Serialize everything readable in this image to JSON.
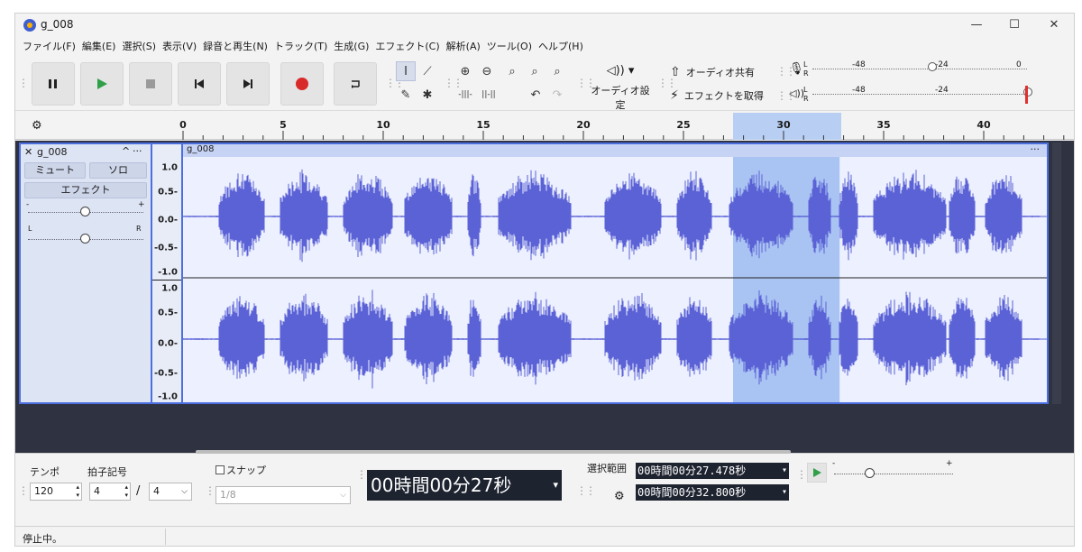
{
  "window": {
    "title": "g_008",
    "minimize": "—",
    "maximize": "☐",
    "close": "✕"
  },
  "menu": [
    "ファイル(F)",
    "編集(E)",
    "選択(S)",
    "表示(V)",
    "録音と再生(N)",
    "トラック(T)",
    "生成(G)",
    "エフェクト(C)",
    "解析(A)",
    "ツール(O)",
    "ヘルプ(H)"
  ],
  "toolbar": {
    "audio_settings": "オーディオ設定",
    "audio_share": "オーディオ共有",
    "get_effects": "エフェクトを取得",
    "meter_rec_ticks": [
      "-48",
      "-24",
      "0"
    ],
    "meter_play_ticks": [
      "-48",
      "-24"
    ],
    "meter_l": "L",
    "meter_r": "R"
  },
  "ruler": {
    "labels": [
      "0",
      "5",
      "10",
      "15",
      "20",
      "25",
      "30",
      "35",
      "40"
    ],
    "selection_start_s": 27.478,
    "selection_end_s": 32.8
  },
  "track": {
    "name": "g_008",
    "clip_name": "g_008",
    "mute": "ミュート",
    "solo": "ソロ",
    "effects": "エフェクト",
    "gain_minus": "-",
    "gain_plus": "+",
    "pan_l": "L",
    "pan_r": "R",
    "collapse": "^",
    "menu": "···",
    "clip_menu": "···",
    "close": "✕",
    "scale_top": [
      "1.0",
      "0.5-",
      "0.0-",
      "-0.5-",
      "-1.0"
    ],
    "scale_bottom": [
      "1.0",
      "0.5-",
      "0.0-",
      "-0.5-",
      "-1.0"
    ]
  },
  "bottom": {
    "tempo_label": "テンポ",
    "tempo_value": "120",
    "time_sig_label": "拍子記号",
    "time_sig_num": "4",
    "time_sig_slash": "/",
    "time_sig_den": "4",
    "snap_label": "スナップ",
    "snap_value": "1/8",
    "time_display": "00時間00分27秒",
    "selection_label": "選択範囲",
    "sel_start": "00時間00分27.478秒",
    "sel_end": "00時間00分32.800秒",
    "play_minus": "-",
    "play_plus": "+"
  },
  "status": "停止中。",
  "colors": {
    "waveform": "#5b62d6",
    "selection": "#a9c4f3",
    "record": "#d92a2a",
    "play": "#2fa049"
  }
}
